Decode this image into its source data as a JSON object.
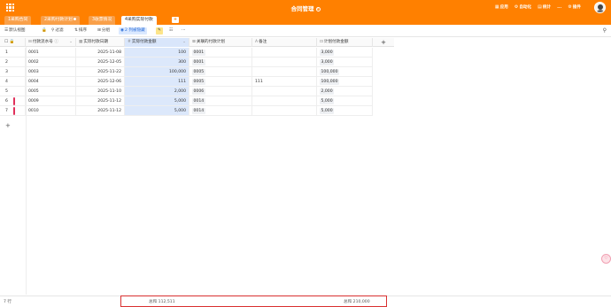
{
  "app": {
    "title": "合同管理"
  },
  "top_actions": [
    {
      "icon": "app-icon",
      "label": "应用"
    },
    {
      "icon": "automation-icon",
      "label": "自动化"
    },
    {
      "icon": "chart-icon",
      "label": "统计"
    },
    {
      "icon": "more-icon",
      "label": "..."
    },
    {
      "icon": "settings-icon",
      "label": "插件"
    }
  ],
  "tabs": [
    "1采购合同",
    "2采购付款计划",
    "3收票情况",
    "4采购实际付款"
  ],
  "toolbar": {
    "view": "默认视图",
    "filter": "过滤",
    "sort": "排序",
    "group": "分组",
    "hidden": "2 列被隐藏",
    "more": "···"
  },
  "columns": [
    {
      "name": "付款流水号",
      "type_icon": "sequence-icon"
    },
    {
      "name": "实际付款日期",
      "type_icon": "calendar-icon"
    },
    {
      "name": "实际付款金额",
      "type_icon": "number-icon"
    },
    {
      "name": "关联的付款计划",
      "type_icon": "link-icon"
    },
    {
      "name": "备注",
      "type_icon": "text-icon"
    },
    {
      "name": "计划付款金额",
      "type_icon": "formula-icon"
    }
  ],
  "rows": [
    {
      "no": "1",
      "id": "0001",
      "date": "2025-11-08",
      "amount": "100",
      "plan": "0001",
      "note": "",
      "plan_amount": "3,000",
      "mark": false
    },
    {
      "no": "2",
      "id": "0002",
      "date": "2025-12-05",
      "amount": "300",
      "plan": "0001",
      "note": "",
      "plan_amount": "3,000",
      "mark": false
    },
    {
      "no": "3",
      "id": "0003",
      "date": "2025-11-22",
      "amount": "100,000",
      "plan": "0005",
      "note": "",
      "plan_amount": "100,000",
      "mark": false
    },
    {
      "no": "4",
      "id": "0004",
      "date": "2025-12-06",
      "amount": "111",
      "plan": "0005",
      "note": "111",
      "plan_amount": "100,000",
      "mark": false
    },
    {
      "no": "5",
      "id": "0005",
      "date": "2025-11-10",
      "amount": "2,000",
      "plan": "0006",
      "note": "",
      "plan_amount": "2,000",
      "mark": false
    },
    {
      "no": "6",
      "id": "0009",
      "date": "2025-11-12",
      "amount": "5,000",
      "plan": "0014",
      "note": "",
      "plan_amount": "5,000",
      "mark": true
    },
    {
      "no": "7",
      "id": "0010",
      "date": "2025-11-12",
      "amount": "5,000",
      "plan": "0014",
      "note": "",
      "plan_amount": "5,000",
      "mark": true
    }
  ],
  "footer": {
    "count": "7 行",
    "sum_amount": "总和 112,511",
    "sum_plan": "总和 210,000"
  },
  "colors": {
    "brand": "#ff8000",
    "highlight": "#dce8fb",
    "mark": "#e0305a",
    "footer_box": "#d93030"
  }
}
